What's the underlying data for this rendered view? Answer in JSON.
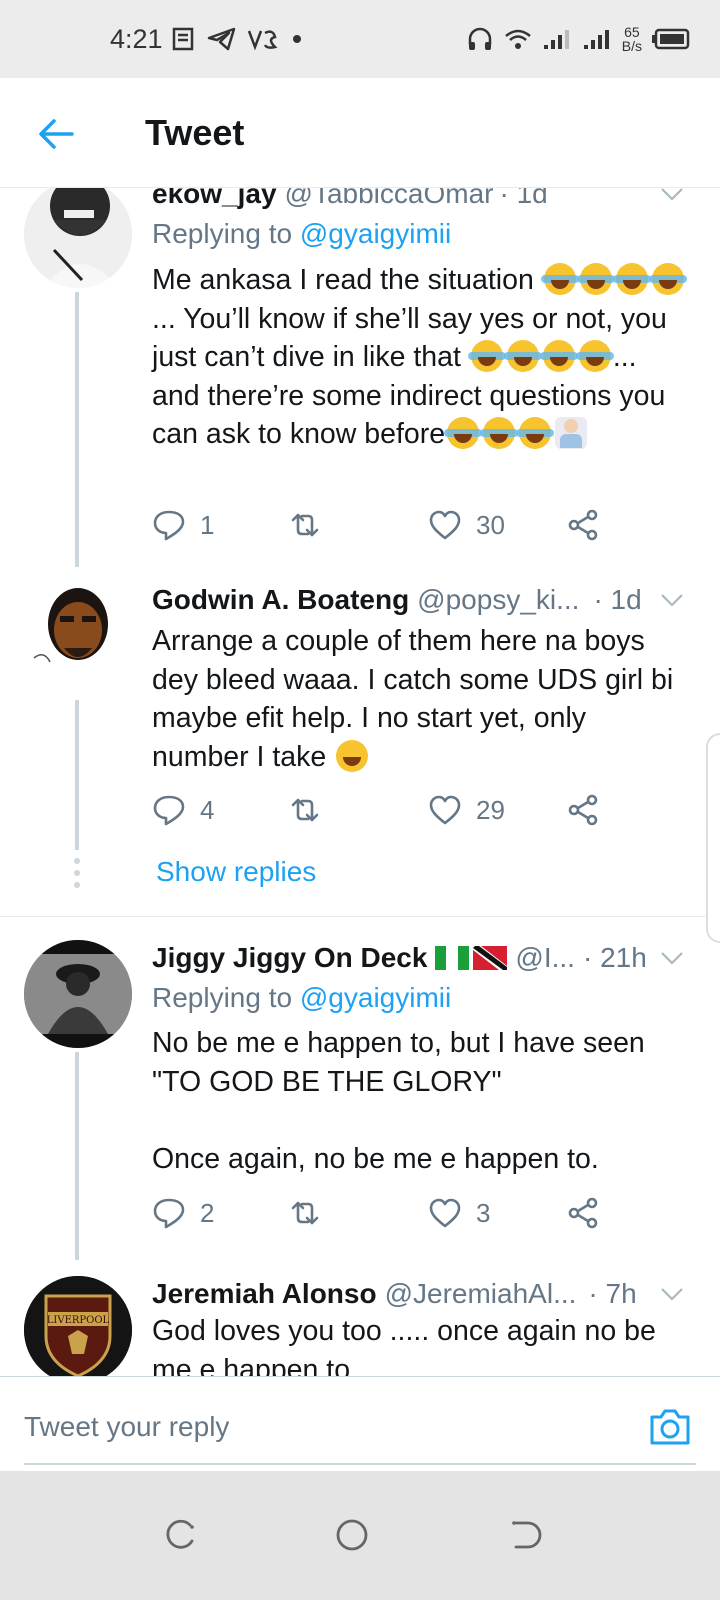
{
  "status_bar": {
    "time": "4:21",
    "net_speed_value": "65",
    "net_speed_unit": "B/s"
  },
  "app_bar": {
    "title": "Tweet"
  },
  "tweets": [
    {
      "name": "ekow_jay",
      "handle": "@TabbiccaOmar",
      "time": "· 1d",
      "replying_label": "Replying to ",
      "replying_to": "@gyaigyimii",
      "body_parts": [
        "Me ankasa I read the situation ",
        "... You’ll know if she’ll say yes or not, you just can’t dive in like that ",
        "... and there’re some indirect questions you can ask to know before"
      ],
      "replies": "1",
      "retweets": "",
      "likes": "30"
    },
    {
      "name": "Godwin A. Boateng",
      "handle": "@popsy_ki...",
      "time": "· 1d",
      "body": "Arrange a couple of them here na boys dey bleed waaa. I catch some UDS girl bi maybe efit help. I no start yet, only number I take ",
      "replies": "4",
      "retweets": "",
      "likes": "29",
      "show_replies": "Show replies"
    },
    {
      "name": "Jiggy Jiggy On Deck",
      "handle": "@I...",
      "time": "· 21h",
      "replying_label": "Replying to ",
      "replying_to": "@gyaigyimii",
      "body": "No be me e happen to, but I have seen \"TO GOD BE THE GLORY\"\n\nOnce again, no be me e happen to.",
      "replies": "2",
      "retweets": "",
      "likes": "3"
    },
    {
      "name": "Jeremiah Alonso",
      "handle": "@JeremiahAl...",
      "time": "· 7h",
      "body": "God loves you too ..... once again no be me e happen to",
      "avatar_text": "LIVERPOOL"
    }
  ],
  "compose": {
    "placeholder": "Tweet your reply"
  },
  "colors": {
    "accent": "#1da1f2",
    "secondary_text": "#657786",
    "divider": "#e6ecf0"
  }
}
